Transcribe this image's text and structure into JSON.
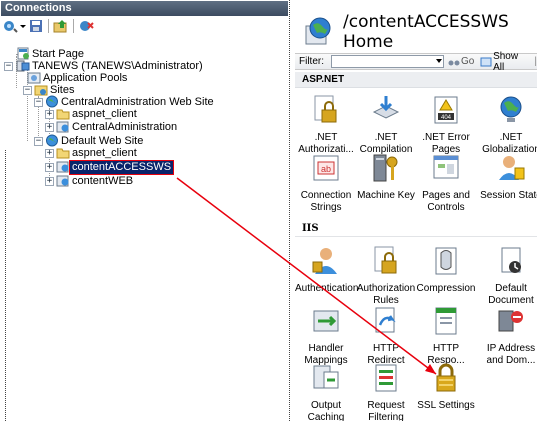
{
  "connections": {
    "title": "Connections",
    "toolbar": [
      "connect-icon",
      "save-icon",
      "up-icon",
      "disconnect-icon"
    ],
    "tree": [
      {
        "label": "Start Page"
      },
      {
        "label": "TANEWS (TANEWS\\Administrator)"
      },
      {
        "label": "Application Pools"
      },
      {
        "label": "Sites"
      },
      {
        "label": "CentralAdministration Web Site"
      },
      {
        "label": "aspnet_client"
      },
      {
        "label": "CentralAdministration"
      },
      {
        "label": "Default Web Site"
      },
      {
        "label": "aspnet_client"
      },
      {
        "label": "contentACCESSWS",
        "selected": true
      },
      {
        "label": "contentWEB"
      }
    ]
  },
  "main": {
    "title": "/contentACCESSWS Home",
    "filter": {
      "label": "Filter:",
      "value": "",
      "go_label": "Go",
      "show_all_label": "Show All",
      "more": "|"
    },
    "sections": [
      {
        "name": "ASP.NET",
        "features": [
          {
            "label": ".NET\nAuthorizati...",
            "icon": "authorization-lock-icon"
          },
          {
            "label": ".NET\nCompilation",
            "icon": "compilation-icon"
          },
          {
            "label": ".NET Error\nPages",
            "icon": "error-page-icon",
            "badge": "404"
          },
          {
            "label": ".NET\nGlobalization",
            "icon": "globe-icon"
          },
          {
            "label": "Connection\nStrings",
            "icon": "connection-strings-icon",
            "badge": "ab"
          },
          {
            "label": "Machine Key",
            "icon": "machine-key-icon"
          },
          {
            "label": "Pages and\nControls",
            "icon": "pages-controls-icon"
          },
          {
            "label": "Session State",
            "icon": "session-state-icon"
          }
        ]
      },
      {
        "name": "IIS",
        "features": [
          {
            "label": "Authentication",
            "icon": "authentication-icon"
          },
          {
            "label": "Authorization\nRules",
            "icon": "authorization-rules-icon"
          },
          {
            "label": "Compression",
            "icon": "compression-icon"
          },
          {
            "label": "Default\nDocument",
            "icon": "default-document-icon"
          },
          {
            "label": "Handler\nMappings",
            "icon": "handler-mappings-icon"
          },
          {
            "label": "HTTP Redirect",
            "icon": "http-redirect-icon"
          },
          {
            "label": "HTTP\nRespo...",
            "icon": "http-response-icon"
          },
          {
            "label": "IP Address\nand Dom...",
            "icon": "ip-address-icon"
          },
          {
            "label": "Output\nCaching",
            "icon": "output-caching-icon"
          },
          {
            "label": "Request\nFiltering",
            "icon": "request-filtering-icon"
          },
          {
            "label": "SSL Settings",
            "icon": "ssl-lock-icon"
          }
        ]
      }
    ]
  },
  "annotation": {
    "color": "#e8000d",
    "from": "contentACCESSWS",
    "to": "SSL Settings"
  },
  "colors": {
    "header": "#4a5a70",
    "selection": "#0a246a",
    "arrow": "#e8000d"
  }
}
